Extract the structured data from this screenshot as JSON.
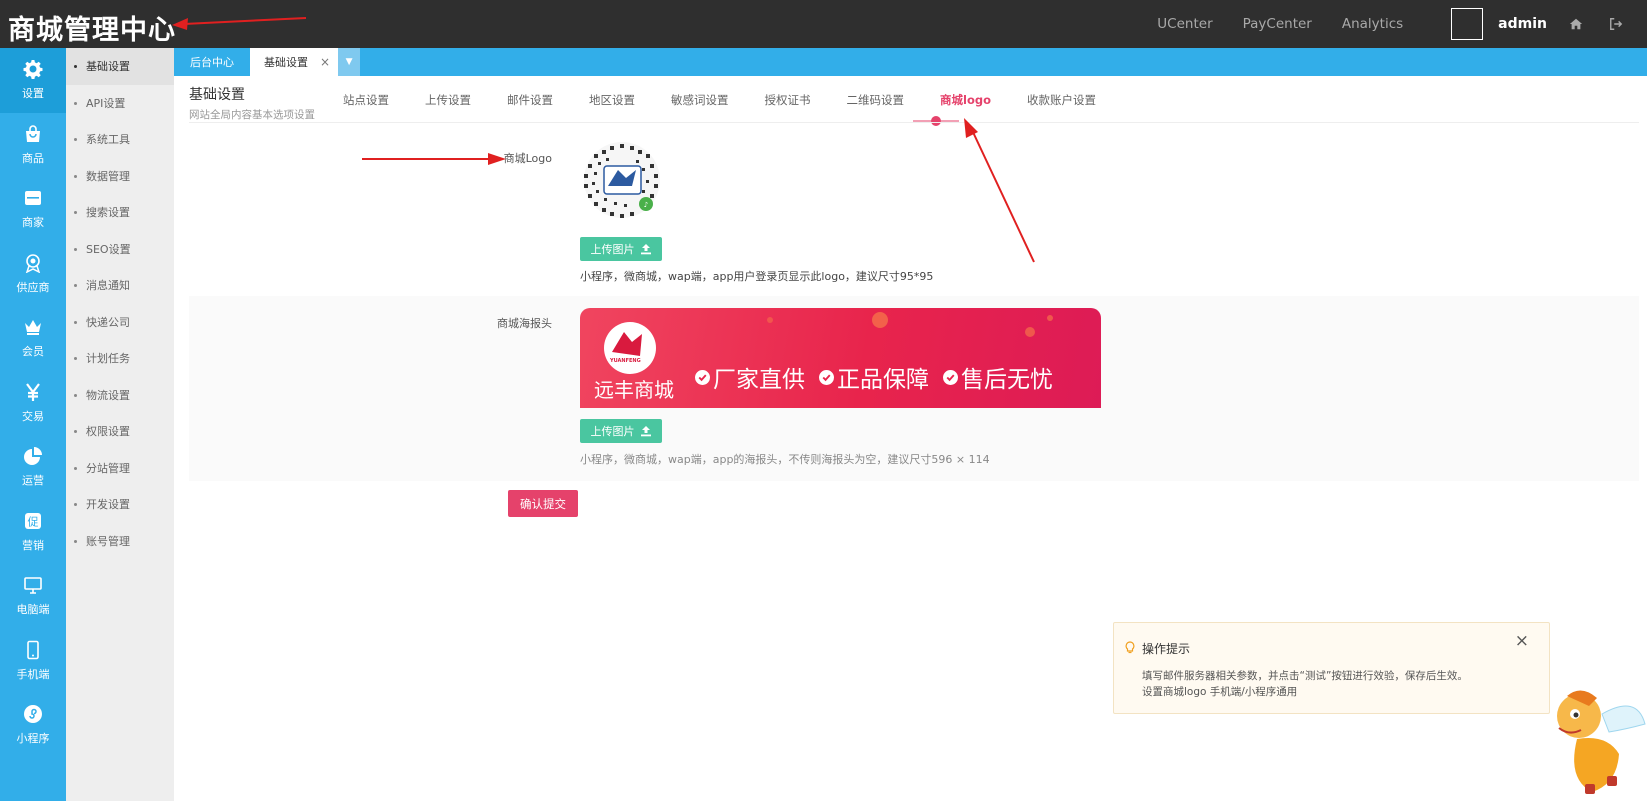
{
  "header": {
    "title": "商城管理中心",
    "links": [
      "UCenter",
      "PayCenter",
      "Analytics"
    ],
    "user": "admin"
  },
  "leftnav": [
    {
      "label": "设置",
      "icon": "gear-icon"
    },
    {
      "label": "商品",
      "icon": "shopping-bag-icon"
    },
    {
      "label": "商家",
      "icon": "store-icon"
    },
    {
      "label": "供应商",
      "icon": "medal-icon"
    },
    {
      "label": "会员",
      "icon": "crown-icon"
    },
    {
      "label": "交易",
      "icon": "yuan-icon"
    },
    {
      "label": "运营",
      "icon": "pie-chart-icon"
    },
    {
      "label": "营销",
      "icon": "promotion-icon"
    },
    {
      "label": "电脑端",
      "icon": "monitor-icon"
    },
    {
      "label": "手机端",
      "icon": "phone-icon"
    },
    {
      "label": "小程序",
      "icon": "mini-program-icon"
    }
  ],
  "subnav": [
    "基础设置",
    "API设置",
    "系统工具",
    "数据管理",
    "搜索设置",
    "SEO设置",
    "消息通知",
    "快递公司",
    "计划任务",
    "物流设置",
    "权限设置",
    "分站管理",
    "开发设置",
    "账号管理"
  ],
  "tabs": {
    "home": "后台中心",
    "current": "基础设置",
    "close": "×"
  },
  "page": {
    "title": "基础设置",
    "subtitle": "网站全局内容基本选项设置",
    "subtabs": [
      "站点设置",
      "上传设置",
      "邮件设置",
      "地区设置",
      "敏感词设置",
      "授权证书",
      "二维码设置",
      "商城logo",
      "收款账户设置"
    ],
    "active_subtab": 7
  },
  "form": {
    "logo_label": "商城Logo",
    "upload_label": "上传图片",
    "logo_hint": "小程序，微商城，wap端，app用户登录页显示此logo，建议尺寸95*95",
    "poster_label": "商城海报头",
    "poster_hint": "小程序，微商城，wap端，app的海报头，不传则海报头为空，建议尺寸596 × 114",
    "submit_label": "确认提交"
  },
  "poster": {
    "brand": "远丰商城",
    "logo_text": "YUANFENG",
    "features": [
      "厂家直供",
      "正品保障",
      "售后无忧"
    ]
  },
  "tip": {
    "title": "操作提示",
    "close": "×",
    "lines": [
      "填写邮件服务器相关参数，并点击“测试”按钮进行效验，保存后生效。",
      "设置商城logo 手机端/小程序通用"
    ]
  },
  "colors": {
    "topbar": "#2f2f2f",
    "nav": "#32aee9",
    "accent": "#e5426b",
    "upload": "#4ac6a0"
  }
}
